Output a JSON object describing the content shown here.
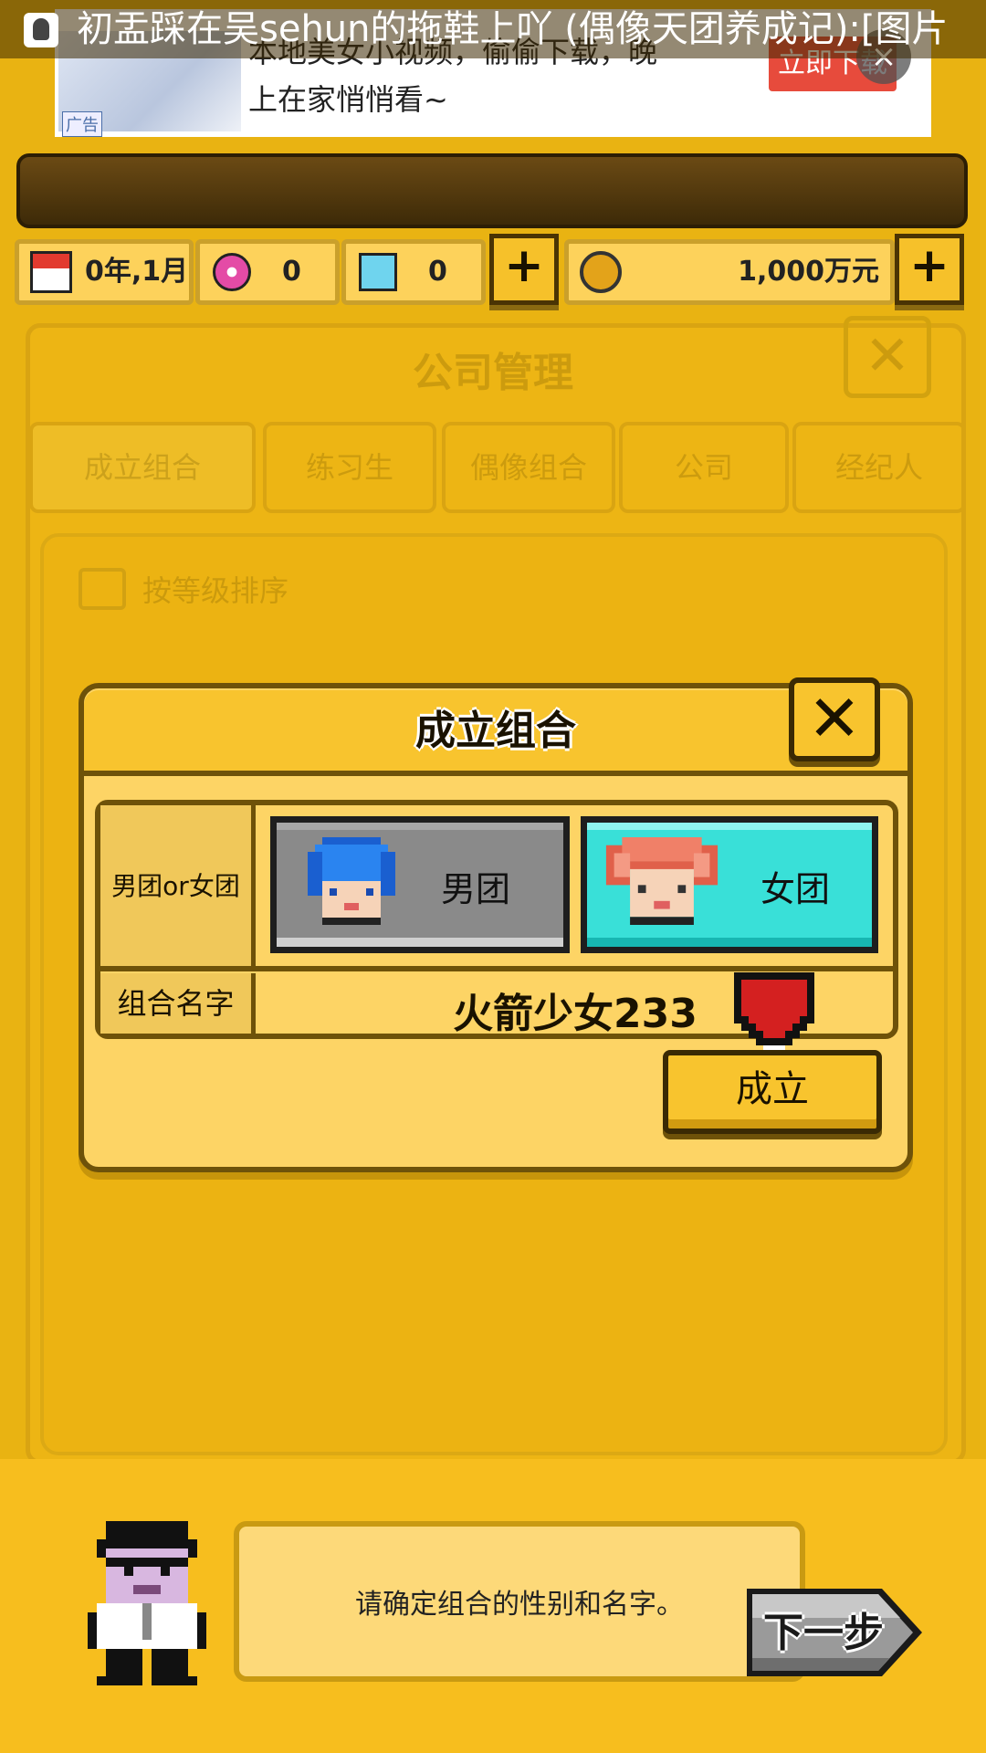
{
  "notification": {
    "text": "初盂踩在吴sehun的拖鞋上吖 (偶像天团养成记):[图片"
  },
  "ad": {
    "line1": "本地美女小视频，偷偷下载，晚",
    "line2": "上在家悄悄看~",
    "tag": "广告",
    "button": "立即下载",
    "close": "×"
  },
  "resources": {
    "date": "0年,1月",
    "gems": "0",
    "diamonds": "0",
    "money": "1,000万元",
    "plus": "+"
  },
  "background": {
    "title": "公司管理",
    "close": "✕",
    "tabs": [
      "成立组合",
      "练习生",
      "偶像组合",
      "公司",
      "经纪人"
    ],
    "sort_label": "按等级排序"
  },
  "dialog": {
    "title": "成立组合",
    "close": "✕",
    "gender_label": "男团or女团",
    "boy_label": "男团",
    "girl_label": "女团",
    "name_label": "组合名字",
    "group_name": "火箭少女233",
    "confirm": "成立",
    "selected": "女团"
  },
  "guide": {
    "message": "请确定组合的性别和名字。",
    "next": "下一步"
  },
  "colors": {
    "bg": "#e9b312",
    "dialog": "#fdd465",
    "girl_selected": "#39e0d8",
    "boy": "#8a8a8a",
    "heart": "#d42020"
  }
}
